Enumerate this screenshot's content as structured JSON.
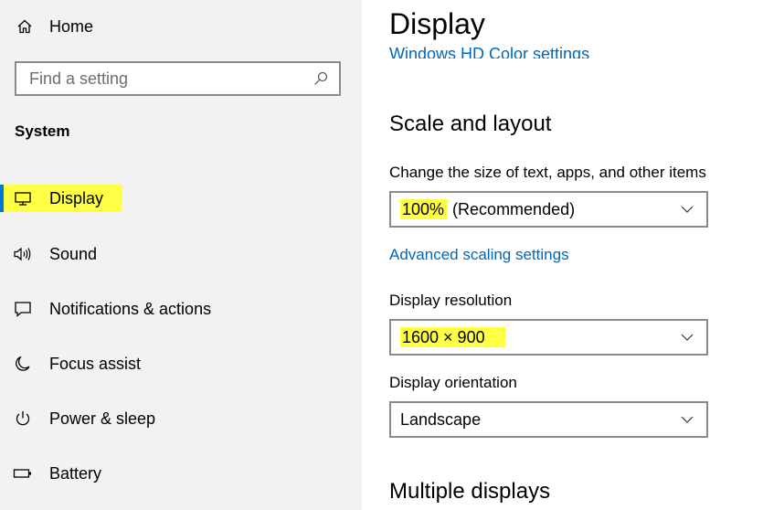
{
  "sidebar": {
    "home_label": "Home",
    "search_placeholder": "Find a setting",
    "section_title": "System",
    "items": [
      {
        "label": "Display",
        "icon": "monitor-icon"
      },
      {
        "label": "Sound",
        "icon": "speaker-icon"
      },
      {
        "label": "Notifications & actions",
        "icon": "notification-icon"
      },
      {
        "label": "Focus assist",
        "icon": "moon-icon"
      },
      {
        "label": "Power & sleep",
        "icon": "power-icon"
      },
      {
        "label": "Battery",
        "icon": "battery-icon"
      }
    ]
  },
  "main": {
    "title": "Display",
    "cut_link": "Windows HD Color settings",
    "scale_heading": "Scale and layout",
    "scale_label": "Change the size of text, apps, and other items",
    "scale_value_highlight": "100%",
    "scale_value_rest": " (Recommended)",
    "advanced_link": "Advanced scaling settings",
    "resolution_label": "Display resolution",
    "resolution_value": "1600 × 900",
    "orientation_label": "Display orientation",
    "orientation_value": "Landscape",
    "multiple_heading": "Multiple displays"
  },
  "colors": {
    "highlight": "#ffff44",
    "link": "#0067b8",
    "sidebar_bg": "#f2f2f2"
  }
}
